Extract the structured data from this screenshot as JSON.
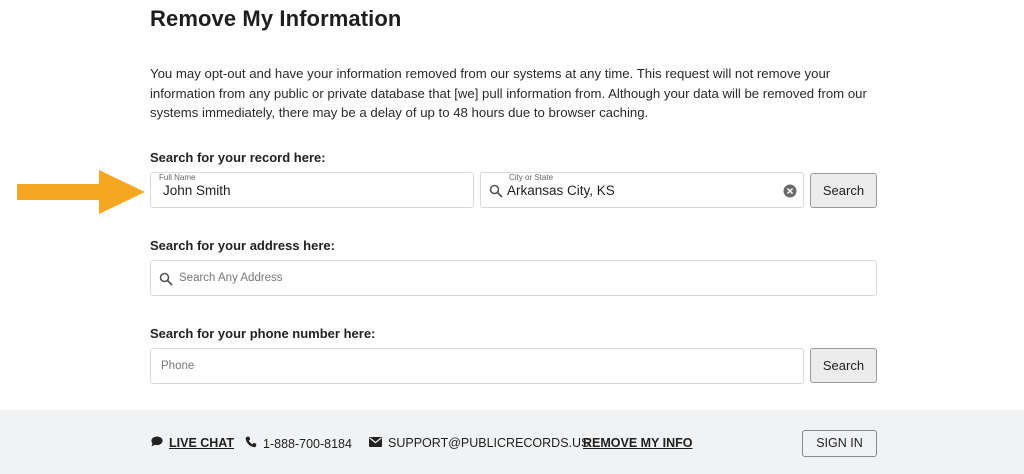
{
  "page": {
    "title": "Remove My Information",
    "intro": "You may opt-out and have your information removed from our systems at any time. This request will not remove your information from any public or private database that [we] pull information from. Although your data will be removed from our systems immediately, there may be a delay of up to 48 hours due to browser caching."
  },
  "record_search": {
    "label": "Search for your record here:",
    "full_name_label": "Full Name",
    "full_name_value": "John Smith",
    "location_label": "City or State",
    "location_value": "Arkansas City, KS",
    "button": "Search"
  },
  "address_search": {
    "label": "Search for your address here:",
    "placeholder": "Search Any Address"
  },
  "phone_search": {
    "label": "Search for your phone number here:",
    "placeholder": "Phone",
    "button": "Search"
  },
  "footer": {
    "live_chat": "LIVE CHAT",
    "phone": "1-888-700-8184",
    "email": "SUPPORT@PUBLICRECORDS.US",
    "remove_info": "REMOVE MY INFO",
    "sign_in": "SIGN IN"
  },
  "colors": {
    "arrow": "#f5a623",
    "footer_bg": "#f1f2f3",
    "button_bg": "#ececec"
  }
}
